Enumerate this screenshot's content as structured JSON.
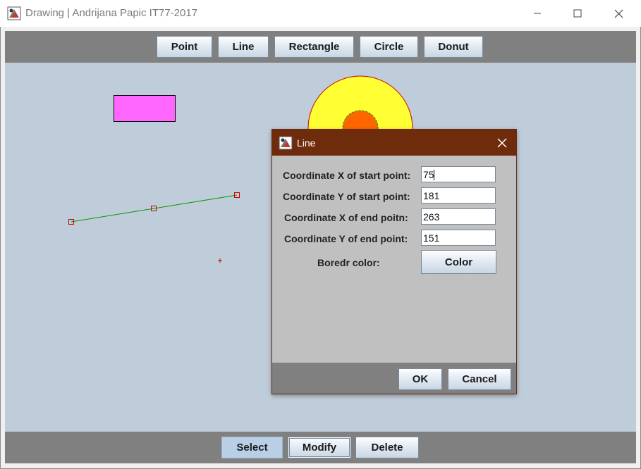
{
  "window": {
    "title": "Drawing | Andrijana Papic IT77-2017",
    "icon": "app-drawing-icon",
    "controls": [
      "minimize-icon",
      "maximize-icon",
      "close-icon"
    ]
  },
  "toolbar_top": {
    "buttons": [
      "Point",
      "Line",
      "Rectangle",
      "Circle",
      "Donut"
    ]
  },
  "toolbar_bottom": {
    "select_label": "Select",
    "modify_label": "Modify",
    "delete_label": "Delete",
    "selected": "Select"
  },
  "canvas": {
    "background": "#bfccd9",
    "shapes": [
      {
        "type": "rectangle",
        "fill": "#ff66ff",
        "stroke": "#000000"
      },
      {
        "type": "donut",
        "outer_fill": "#ffff33",
        "inner_fill": "#ff6600",
        "stroke": "#cc0000",
        "inner_stroke": "#009900"
      },
      {
        "type": "line",
        "stroke": "#009900",
        "selected": true,
        "handle_color": "#cc0000"
      },
      {
        "type": "point",
        "color": "#cc0000"
      }
    ]
  },
  "dialog": {
    "title": "Line",
    "icon": "app-drawing-icon",
    "fields": [
      {
        "label": "Coordinate X of start point:",
        "value": "75"
      },
      {
        "label": "Coordinate Y of start point:",
        "value": "181"
      },
      {
        "label": "Coordinate X of end poitn:",
        "value": "263"
      },
      {
        "label": "Coordinate Y of end point:",
        "value": "151"
      }
    ],
    "border_color_label": "Boredr color:",
    "color_button": "Color",
    "ok_label": "OK",
    "cancel_label": "Cancel",
    "title_color": "#6e2c0c"
  }
}
